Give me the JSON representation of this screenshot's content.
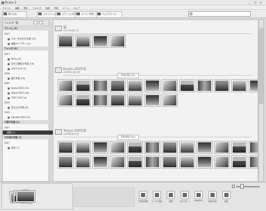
{
  "window": {
    "title": "Picasa 3",
    "controls": [
      "_",
      "□",
      "×"
    ]
  },
  "menu": [
    "ファイル",
    "編集",
    "表示",
    "フォルダ",
    "画像",
    "作成",
    "ツール",
    "ヘルプ"
  ],
  "toolbar": {
    "import": "取り込み",
    "slideshow": "スライドショー",
    "collage": "コラージュを作成",
    "movie": "ムービー作成",
    "web": "ウェブアルバム"
  },
  "sidebar": {
    "header": "フォルダ一覧",
    "rows": [
      {
        "label": "アルバム (3)",
        "kind": "section"
      },
      {
        "label": "2007",
        "kind": "year"
      },
      {
        "label": "スターを付けた写真 (27)",
        "kind": "item"
      },
      {
        "label": "画面キャプチャ (4)",
        "kind": "item"
      },
      {
        "label": "フォルダ (8)",
        "kind": "section"
      },
      {
        "label": "2007",
        "kind": "year"
      },
      {
        "label": "Temp (3)",
        "kind": "item"
      },
      {
        "label": "日光と鎌倉の写真 (16)",
        "kind": "item"
      },
      {
        "label": "2007-4-21 (1)",
        "kind": "item"
      },
      {
        "label": "2006",
        "kind": "year"
      },
      {
        "label": "旅行写真 (10)",
        "kind": "item"
      },
      {
        "label": "2005",
        "kind": "year"
      },
      {
        "label": "Kyoto-2005 (22)",
        "kind": "item"
      },
      {
        "label": "Tokyo-2005 (46)",
        "kind": "item"
      },
      {
        "label": "TEST-2007 (4)",
        "kind": "item"
      },
      {
        "label": "2004",
        "kind": "year"
      },
      {
        "label": "富士山の写真 (6)",
        "kind": "item"
      },
      {
        "label": "2003",
        "kind": "year"
      },
      {
        "label": "Canada-2003 (9)",
        "kind": "item"
      },
      {
        "label": "人物の写真 (1)",
        "kind": "section"
      },
      {
        "label": "2007",
        "kind": "year"
      },
      {
        "label": "家族 (1)",
        "kind": "selected"
      },
      {
        "label": "その他の写真 (1)",
        "kind": "section"
      },
      {
        "label": "2007",
        "kind": "year"
      },
      {
        "label": "記念 (1)",
        "kind": "item"
      }
    ]
  },
  "groups": [
    {
      "name": "桜",
      "date": "2007年4月21日",
      "count": 4,
      "button": ""
    },
    {
      "name": "Kyoto-2005年",
      "date": "2005年11月23日",
      "count": 19,
      "button": "写真を取り込む"
    },
    {
      "name": "Tokyo-2005年",
      "date": "2005年3月10日",
      "count": 24,
      "button": "写真を取り込む"
    }
  ],
  "bottom": {
    "actions": [
      {
        "label": "写真を印刷",
        "icon": "printer-icon"
      },
      {
        "label": "メールで送信",
        "icon": "mail-icon"
      },
      {
        "label": "印刷",
        "icon": "print-order-icon"
      },
      {
        "label": "エクスポート",
        "icon": "export-icon"
      },
      {
        "label": "BlogThis!",
        "icon": "blog-icon"
      },
      {
        "label": "写真を共有",
        "icon": "share-icon"
      },
      {
        "label": "保存",
        "icon": "save-icon"
      }
    ]
  }
}
